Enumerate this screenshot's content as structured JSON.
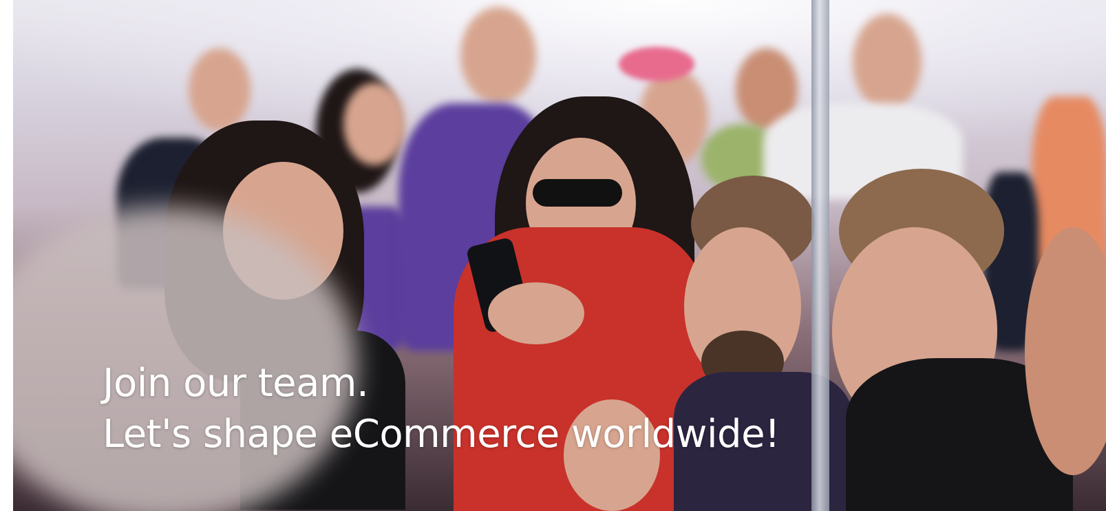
{
  "hero": {
    "image_description_icon": "photo-icon",
    "headline_line1": "Join our team.",
    "headline_line2": "Let's shape eCommerce worldwide!"
  },
  "colors": {
    "headline_text": "#ffffff",
    "background": "#ffffff"
  }
}
